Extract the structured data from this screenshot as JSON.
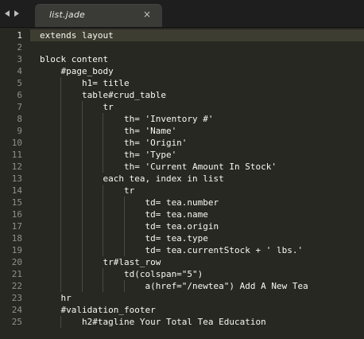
{
  "tab": {
    "title": "list.jade",
    "close_glyph": "×"
  },
  "nav": {
    "back_icon": "chevron-left",
    "forward_icon": "chevron-right"
  },
  "editor": {
    "current_line": 1,
    "lines": [
      {
        "no": "1",
        "text": "extends layout"
      },
      {
        "no": "2",
        "text": ""
      },
      {
        "no": "3",
        "text": "block content"
      },
      {
        "no": "4",
        "text": "    #page_body"
      },
      {
        "no": "5",
        "text": "        h1= title"
      },
      {
        "no": "6",
        "text": "        table#crud_table"
      },
      {
        "no": "7",
        "text": "            tr"
      },
      {
        "no": "8",
        "text": "                th= 'Inventory #'"
      },
      {
        "no": "9",
        "text": "                th= 'Name'"
      },
      {
        "no": "10",
        "text": "                th= 'Origin'"
      },
      {
        "no": "11",
        "text": "                th= 'Type'"
      },
      {
        "no": "12",
        "text": "                th= 'Current Amount In Stock'"
      },
      {
        "no": "13",
        "text": "            each tea, index in list"
      },
      {
        "no": "14",
        "text": "                tr"
      },
      {
        "no": "15",
        "text": "                    td= tea.number"
      },
      {
        "no": "16",
        "text": "                    td= tea.name"
      },
      {
        "no": "17",
        "text": "                    td= tea.origin"
      },
      {
        "no": "18",
        "text": "                    td= tea.type"
      },
      {
        "no": "19",
        "text": "                    td= tea.currentStock + ' lbs.'"
      },
      {
        "no": "20",
        "text": "            tr#last_row"
      },
      {
        "no": "21",
        "text": "                td(colspan=\"5\")"
      },
      {
        "no": "22",
        "text": "                    a(href=\"/newtea\") Add A New Tea"
      },
      {
        "no": "23",
        "text": "    hr"
      },
      {
        "no": "24",
        "text": "    #validation_footer"
      },
      {
        "no": "25",
        "text": "        h2#tagline Your Total Tea Education"
      }
    ]
  },
  "colors": {
    "background": "#272822",
    "current_line": "#3e3d32",
    "text": "#f8f8f2",
    "gutter_text": "#8f908a",
    "tabbar": "#1e1e1e",
    "tab": "#3a3b36"
  }
}
